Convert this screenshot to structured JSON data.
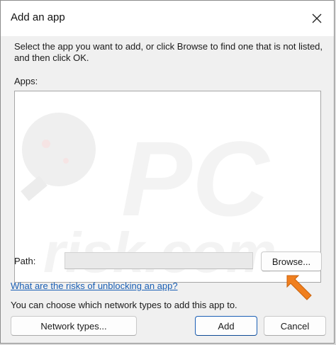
{
  "window": {
    "title": "Add an app"
  },
  "description": "Select the app you want to add, or click Browse to find one that is not listed, and then click OK.",
  "apps": {
    "label": "Apps:",
    "items": []
  },
  "path": {
    "label": "Path:",
    "value": ""
  },
  "buttons": {
    "browse": "Browse...",
    "network_types": "Network types...",
    "add": "Add",
    "cancel": "Cancel"
  },
  "link": {
    "risks": "What are the risks of unblocking an app?"
  },
  "network_text": "You can choose which network types to add this app to.",
  "colors": {
    "link": "#1a5fb4",
    "arrow": "#f07f1e",
    "watermark": "#ebebeb"
  },
  "icons": {
    "close": "close-icon",
    "annotation": "arrow-annotation-icon"
  }
}
